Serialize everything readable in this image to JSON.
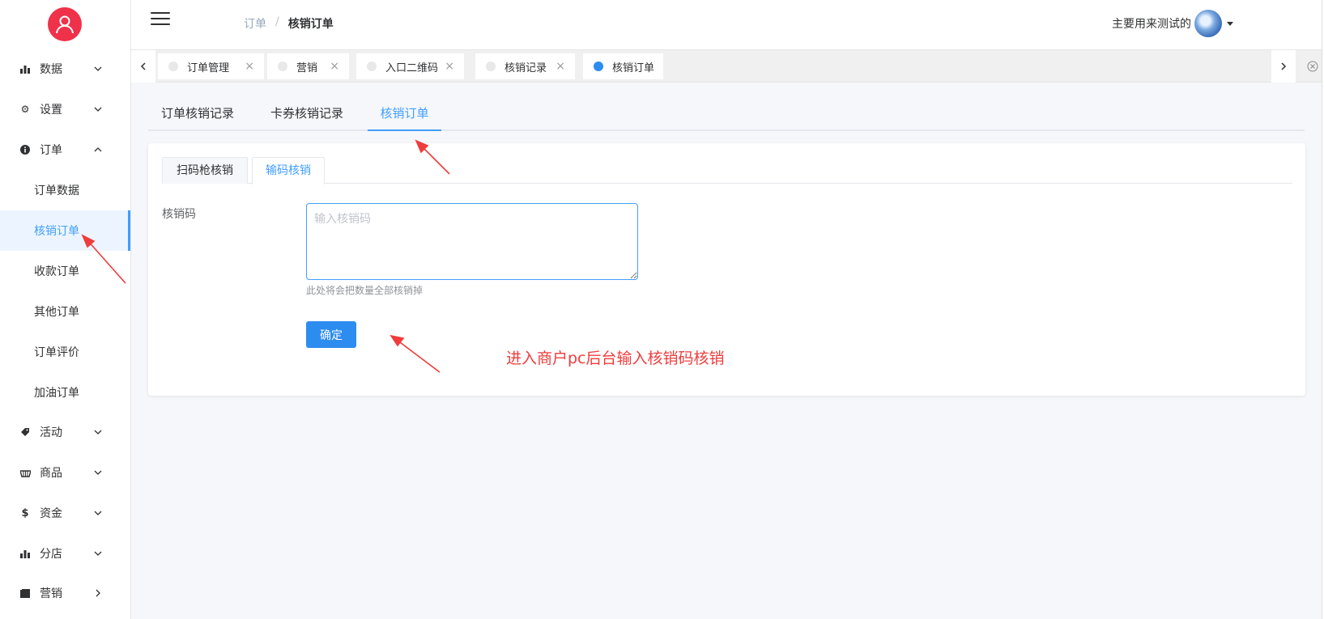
{
  "sidebar": {
    "menu": [
      {
        "label": "数据",
        "icon": "bar-chart-icon"
      },
      {
        "label": "设置",
        "icon": "gear-icon"
      },
      {
        "label": "订单",
        "icon": "info-circle-icon"
      },
      {
        "label": "活动",
        "icon": "tag-icon"
      },
      {
        "label": "商品",
        "icon": "basket-icon"
      },
      {
        "label": "资金",
        "icon": "dollar-icon"
      },
      {
        "label": "分店",
        "icon": "bar-chart-icon"
      },
      {
        "label": "营销",
        "icon": "folder-icon"
      }
    ],
    "submenu": [
      {
        "label": "订单数据"
      },
      {
        "label": "核销订单"
      },
      {
        "label": "收款订单"
      },
      {
        "label": "其他订单"
      },
      {
        "label": "订单评价"
      },
      {
        "label": "加油订单"
      }
    ]
  },
  "header": {
    "breadcrumb": [
      "订单",
      "核销订单"
    ],
    "breadcrumb_sep": "/",
    "username": "主要用来测试的"
  },
  "tags": [
    {
      "label": "订单管理",
      "close": "×"
    },
    {
      "label": "营销",
      "close": "×"
    },
    {
      "label": "入口二维码",
      "close": "×"
    },
    {
      "label": "核销记录",
      "close": "×"
    },
    {
      "label": "核销订单",
      "close": ""
    }
  ],
  "top_tabs": [
    "订单核销记录",
    "卡券核销记录",
    "核销订单"
  ],
  "card_tabs": [
    "扫码枪核销",
    "输码核销"
  ],
  "form": {
    "label": "核销码",
    "placeholder": "输入核销码",
    "hint": "此处将会把数量全部核销掉",
    "submit": "确定"
  },
  "annotation": "进入商户pc后台输入核销码核销",
  "colors": {
    "accent": "#409eff",
    "annotation": "#f03c3c",
    "logo": "#f0314a"
  }
}
